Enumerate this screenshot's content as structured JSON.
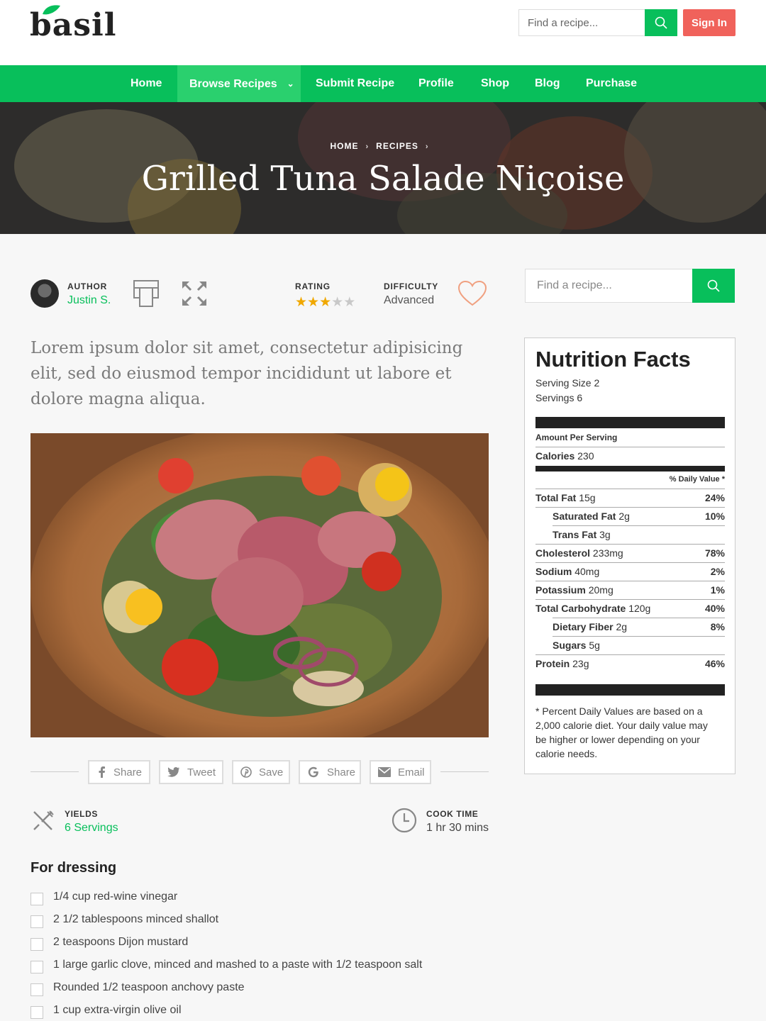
{
  "header": {
    "logo_text": "basil",
    "search_placeholder": "Find a recipe...",
    "signin_label": "Sign In"
  },
  "nav": {
    "items": [
      {
        "label": "Home"
      },
      {
        "label": "Browse Recipes"
      },
      {
        "label": "Submit Recipe"
      },
      {
        "label": "Profile"
      },
      {
        "label": "Shop"
      },
      {
        "label": "Blog"
      },
      {
        "label": "Purchase"
      }
    ]
  },
  "hero": {
    "breadcrumb": [
      "HOME",
      "RECIPES"
    ],
    "title": "Grilled Tuna Salade Niçoise"
  },
  "meta": {
    "author_label": "AUTHOR",
    "author_name": "Justin S.",
    "rating_label": "RATING",
    "rating_value": 3,
    "rating_max": 5,
    "difficulty_label": "DIFFICULTY",
    "difficulty_value": "Advanced"
  },
  "intro": "Lorem ipsum dolor sit amet, consectetur adipisicing elit, sed do eiusmod tempor incididunt ut labore et dolore magna aliqua.",
  "share": {
    "buttons": [
      {
        "label": "Share",
        "icon": "facebook-icon"
      },
      {
        "label": "Tweet",
        "icon": "twitter-icon"
      },
      {
        "label": "Save",
        "icon": "pinterest-icon"
      },
      {
        "label": "Share",
        "icon": "google-icon"
      },
      {
        "label": "Email",
        "icon": "email-icon"
      }
    ]
  },
  "yields": {
    "label": "YIELDS",
    "value": "6 Servings"
  },
  "cook_time": {
    "label": "COOK TIME",
    "value": "1 hr 30 mins"
  },
  "ingredients": {
    "section_title": "For dressing",
    "items": [
      "1/4 cup red-wine vinegar",
      "2 1/2 tablespoons minced shallot",
      "2 teaspoons Dijon mustard",
      "1 large garlic clove, minced and mashed to a paste with 1/2 teaspoon salt",
      "Rounded 1/2 teaspoon anchovy paste",
      "1 cup extra-virgin olive oil"
    ]
  },
  "sidebar": {
    "search_placeholder": "Find a recipe..."
  },
  "nutrition": {
    "title": "Nutrition Facts",
    "serving_size": "Serving Size 2",
    "servings": "Servings 6",
    "amount_per_serving": "Amount Per Serving",
    "calories_label": "Calories",
    "calories_value": "230",
    "daily_value_header": "% Daily Value *",
    "rows": [
      {
        "name": "Total Fat",
        "amount": "15g",
        "dv": "24%"
      },
      {
        "name": "Saturated Fat",
        "amount": "2g",
        "dv": "10%"
      },
      {
        "name": "Trans Fat",
        "amount": "3g",
        "dv": ""
      },
      {
        "name": "Cholesterol",
        "amount": "233mg",
        "dv": "78%"
      },
      {
        "name": "Sodium",
        "amount": "40mg",
        "dv": "2%"
      },
      {
        "name": "Potassium",
        "amount": "20mg",
        "dv": "1%"
      },
      {
        "name": "Total Carbohydrate",
        "amount": "120g",
        "dv": "40%"
      },
      {
        "name": "Dietary Fiber",
        "amount": "2g",
        "dv": "8%"
      },
      {
        "name": "Sugars",
        "amount": "5g",
        "dv": ""
      },
      {
        "name": "Protein",
        "amount": "23g",
        "dv": "46%"
      }
    ],
    "footnote": "* Percent Daily Values are based on a 2,000 calorie diet. Your daily value may be higher or lower depending on your calorie needs."
  },
  "colors": {
    "brand_green": "#08bf5b",
    "signin_red": "#f0625b",
    "star": "#f0a800"
  }
}
